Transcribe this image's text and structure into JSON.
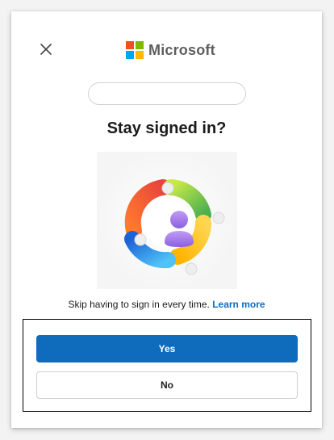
{
  "brand": {
    "name": "Microsoft",
    "logo_colors": [
      "#f25022",
      "#7fba00",
      "#00a4ef",
      "#ffb900"
    ]
  },
  "dialog": {
    "close_icon": "close-icon",
    "title": "Stay signed in?",
    "description": "Skip having to sign in every time.",
    "learn_more": "Learn more",
    "illustration_icon": "person-circle-arrows-icon"
  },
  "buttons": {
    "yes_label": "Yes",
    "no_label": "No"
  },
  "colors": {
    "primary": "#0f6cbd",
    "link": "#0f6cbd"
  }
}
